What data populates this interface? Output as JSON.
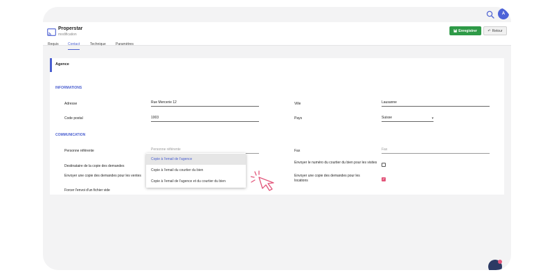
{
  "topbar": {
    "avatar_initials": "A"
  },
  "header": {
    "title": "Properstar",
    "subtitle": "modification",
    "save_label": "Enregistrer",
    "back_label": "Retour"
  },
  "tabs": [
    {
      "label": "Requis"
    },
    {
      "label": "Contact",
      "active": true
    },
    {
      "label": "Technique"
    },
    {
      "label": "Paramètres"
    }
  ],
  "card": {
    "title": "Agence",
    "info_section": "INFORMATIONS",
    "comm_section": "COMMUNICATION"
  },
  "fields": {
    "adresse": {
      "label": "Adresse",
      "value": "Rue Mercerie 12"
    },
    "ville": {
      "label": "Ville",
      "value": "Lausanne"
    },
    "code_postal": {
      "label": "Code postal",
      "value": "1003"
    },
    "pays": {
      "label": "Pays",
      "value": "Suisse"
    },
    "personne": {
      "label": "Personne référente",
      "placeholder": "Personne référente"
    },
    "fax": {
      "label": "Fax",
      "placeholder": "Fax"
    },
    "destinataire": {
      "label": "Destinataire de la copie des demandes"
    },
    "envoyer_numero": {
      "label": "Envoyer le numéro du courtier du bien pour les visites",
      "checked": false
    },
    "envoyer_copie_ventes": {
      "label": "Envoyer une copie des demandes pour les ventes"
    },
    "envoyer_copie_locations": {
      "label": "Envoyer une copie des demandes pour les locations",
      "checked": true
    },
    "forcer_fichier": {
      "label": "Forcer l'envoi d'un fichier vide"
    }
  },
  "dropdown": {
    "options": [
      "Copie à l'email de l'agence",
      "Copie à l'email du courtier du bien",
      "Copie à l'email de l'agence et du courtier du bien"
    ],
    "highlighted_index": 0
  },
  "colors": {
    "accent": "#4a5fd0",
    "save_green": "#2e9a47",
    "checkbox_pink": "#e2557a",
    "cursor_pink": "#e2557a"
  }
}
